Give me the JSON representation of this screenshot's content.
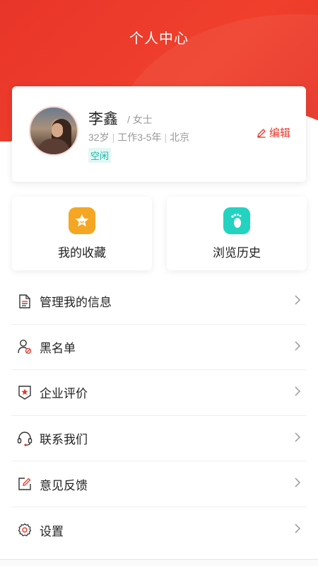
{
  "header": {
    "title": "个人中心"
  },
  "profile": {
    "name": "李鑫",
    "gender": "/ 女士",
    "age": "32岁",
    "experience": "工作3-5年",
    "city": "北京",
    "status": "空闲",
    "edit_label": "编辑"
  },
  "quick_links": {
    "favorites": "我的收藏",
    "history": "浏览历史"
  },
  "menu": {
    "items": [
      {
        "label": "管理我的信息",
        "icon": "document-icon"
      },
      {
        "label": "黑名单",
        "icon": "user-block-icon"
      },
      {
        "label": "企业评价",
        "icon": "badge-star-icon"
      },
      {
        "label": "联系我们",
        "icon": "headset-icon"
      },
      {
        "label": "意见反馈",
        "icon": "edit-feedback-icon"
      },
      {
        "label": "设置",
        "icon": "gear-icon"
      }
    ]
  },
  "colors": {
    "brand": "#e8352a",
    "favorites_icon": "#f5a623",
    "history_icon": "#22d3c0",
    "status": "#16b8a8"
  }
}
